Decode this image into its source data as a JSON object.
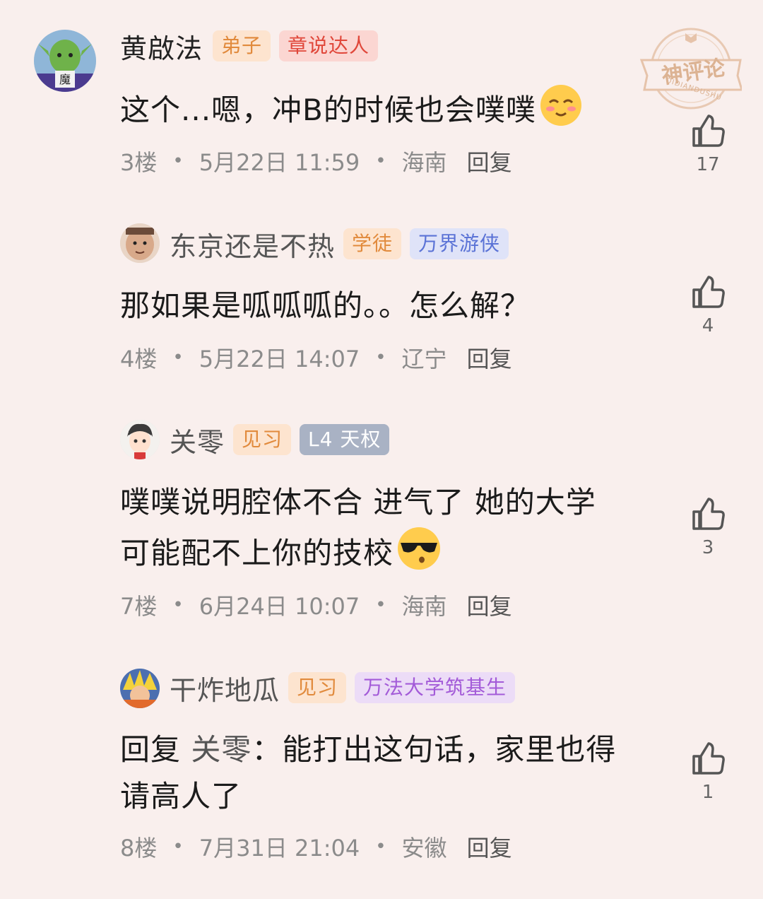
{
  "watermark": {
    "title": "神评论",
    "subtitle": "QIDIANDUSHU"
  },
  "comments": [
    {
      "name": "黄啟法",
      "badges": [
        {
          "label": "弟子",
          "bg": "#fde4cf",
          "fg": "#e18a3c"
        },
        {
          "label": "章说达人",
          "bg": "#fbd6d2",
          "fg": "#e0473a"
        }
      ],
      "text": "这个...嗯，冲B的时候也会噗噗",
      "emoji": "smile-blush-emoji",
      "floor": "3楼",
      "date": "5月22日 11:59",
      "location": "海南",
      "reply": "回复",
      "likes": "17"
    },
    {
      "name": "东京还是不热",
      "badges": [
        {
          "label": "学徒",
          "bg": "#fde4cf",
          "fg": "#e18a3c"
        },
        {
          "label": "万界游侠",
          "bg": "#dfe3f8",
          "fg": "#5b73d6"
        }
      ],
      "text": "那如果是呱呱呱的。。怎么解？",
      "floor": "4楼",
      "date": "5月22日 14:07",
      "location": "辽宁",
      "reply": "回复",
      "likes": "4"
    },
    {
      "name": "关零",
      "badges": [
        {
          "label": "见习",
          "bg": "#fde4cf",
          "fg": "#e18a3c"
        },
        {
          "label": "L4 天权",
          "bg": "#a9b2c4",
          "fg": "#ffffff"
        }
      ],
      "text_line1": "噗噗说明腔体不合 进气了 她的大学",
      "text_line2": "可能配不上你的技校",
      "emoji": "sunglasses-emoji",
      "floor": "7楼",
      "date": "6月24日 10:07",
      "location": "海南",
      "reply": "回复",
      "likes": "3"
    },
    {
      "name": "干炸地瓜",
      "badges": [
        {
          "label": "见习",
          "bg": "#fde4cf",
          "fg": "#e18a3c"
        },
        {
          "label": "万法大学筑基生",
          "bg": "#ecdcf7",
          "fg": "#a35bd8"
        }
      ],
      "reply_prefix": "回复 ",
      "reply_target": "关零",
      "reply_colon": "：",
      "text_line1": "能打出这句话，家里也得",
      "text_line2": "请高人了",
      "floor": "8楼",
      "date": "7月31日 21:04",
      "location": "安徽",
      "reply": "回复",
      "likes": "1"
    }
  ]
}
